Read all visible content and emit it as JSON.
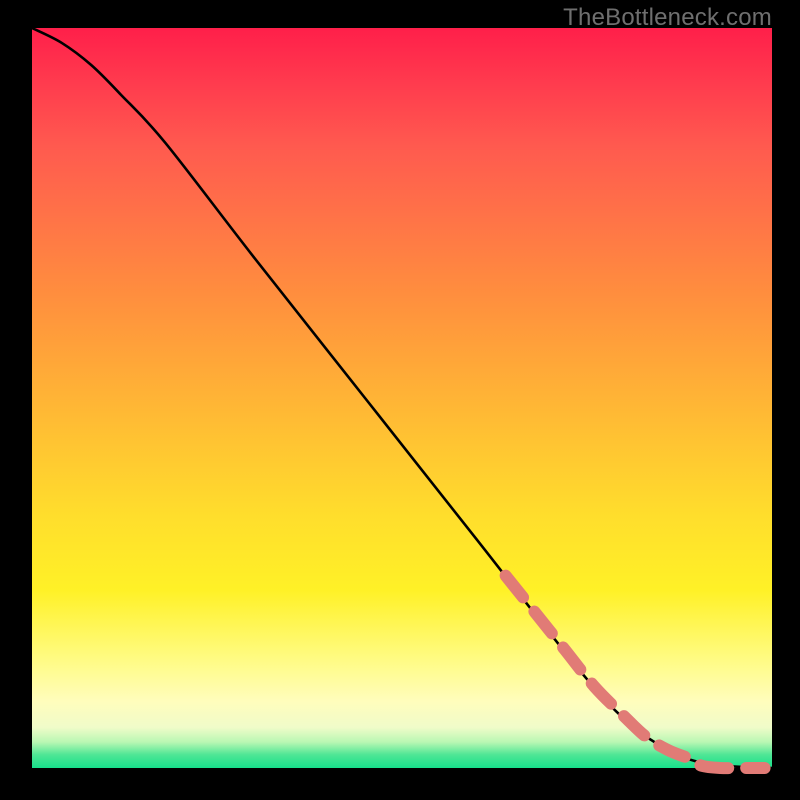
{
  "watermark": "TheBottleneck.com",
  "chart_data": {
    "type": "line",
    "title": "",
    "xlabel": "",
    "ylabel": "",
    "xlim": [
      0,
      100
    ],
    "ylim": [
      0,
      100
    ],
    "grid": false,
    "legend": false,
    "series": [
      {
        "name": "solid-curve",
        "style": "solid",
        "color": "#000000",
        "x": [
          0,
          4,
          8,
          12,
          18,
          30,
          45,
          60,
          75,
          82,
          88,
          92,
          95,
          100
        ],
        "y": [
          100,
          98,
          95,
          91,
          84.5,
          69,
          50,
          31,
          12,
          5,
          1.5,
          0.5,
          0.2,
          0
        ]
      },
      {
        "name": "dashed-overlay-tail",
        "style": "dashed",
        "color": "#e17b76",
        "x": [
          64,
          68,
          72,
          76,
          80,
          83,
          86,
          89,
          90.5,
          93,
          96,
          99
        ],
        "y": [
          26,
          21,
          16,
          11,
          7,
          4.2,
          2.4,
          1.2,
          0.3,
          0,
          0,
          0
        ]
      }
    ],
    "gradient_stops": [
      {
        "pos": 0,
        "color": "#ff1f4a"
      },
      {
        "pos": 0.36,
        "color": "#ff8e3e"
      },
      {
        "pos": 0.66,
        "color": "#ffde2c"
      },
      {
        "pos": 0.91,
        "color": "#fffdbc"
      },
      {
        "pos": 1.0,
        "color": "#17e08b"
      }
    ]
  }
}
